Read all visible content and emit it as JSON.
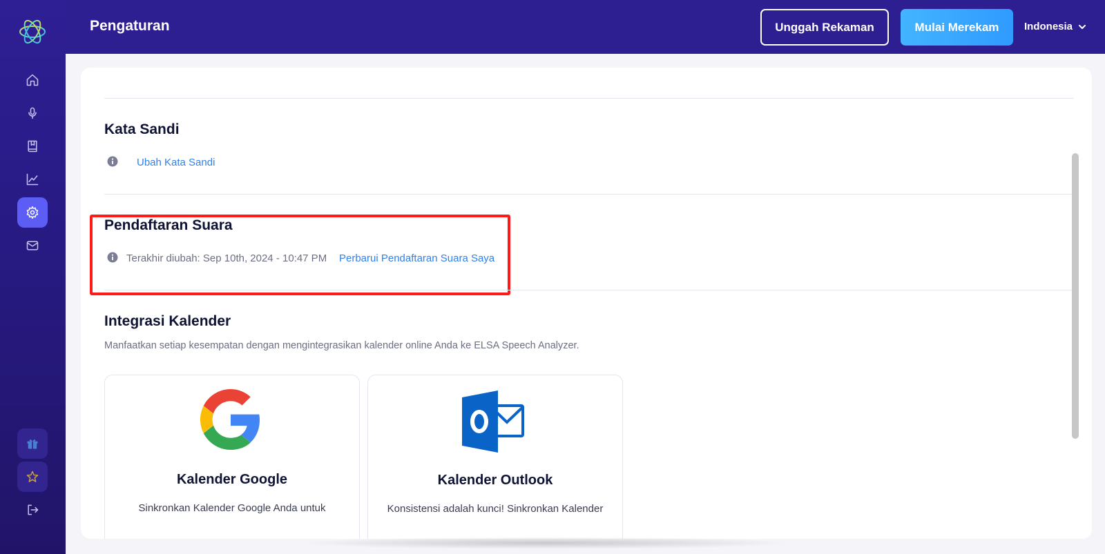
{
  "header": {
    "title": "Pengaturan",
    "upload_label": "Unggah Rekaman",
    "record_label": "Mulai Merekam",
    "language": "Indonesia"
  },
  "sidebar": {
    "items": [
      {
        "icon": "home-icon"
      },
      {
        "icon": "microphone-icon"
      },
      {
        "icon": "book-icon"
      },
      {
        "icon": "chart-icon"
      },
      {
        "icon": "gear-icon",
        "active": true
      },
      {
        "icon": "mail-icon"
      },
      {
        "icon": "gift-icon"
      },
      {
        "icon": "star-icon"
      },
      {
        "icon": "logout-icon"
      }
    ]
  },
  "password": {
    "title": "Kata Sandi",
    "link": "Ubah Kata Sandi"
  },
  "voice": {
    "title": "Pendaftaran Suara",
    "last_changed": "Terakhir diubah: Sep 10th, 2024 - 10:47 PM",
    "link": "Perbarui Pendaftaran Suara Saya"
  },
  "calendar": {
    "title": "Integrasi Kalender",
    "description": "Manfaatkan setiap kesempatan dengan mengintegrasikan kalender online Anda ke ELSA Speech Analyzer.",
    "google": {
      "title": "Kalender Google",
      "desc": "Sinkronkan Kalender Google Anda untuk"
    },
    "outlook": {
      "title": "Kalender Outlook",
      "desc": "Konsistensi adalah kunci! Sinkronkan Kalender"
    }
  },
  "colors": {
    "header_bg": "#2d1e91",
    "accent": "#5b5df5",
    "link": "#2f80ed",
    "highlight": "#ff1a1a"
  }
}
